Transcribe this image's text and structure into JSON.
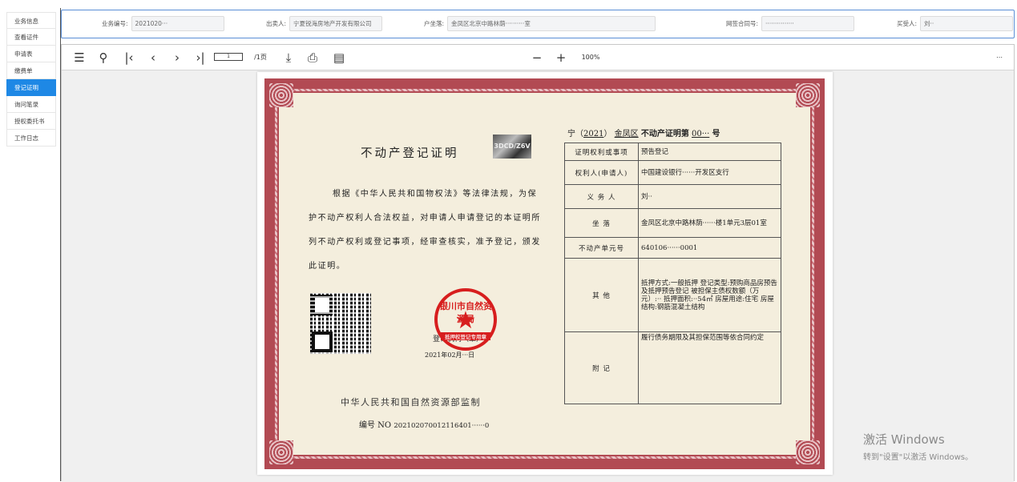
{
  "sidebar": {
    "items": [
      {
        "label": "业务信息",
        "active": false
      },
      {
        "label": "查看证件",
        "active": false
      },
      {
        "label": "申请表",
        "active": false
      },
      {
        "label": "缴费单",
        "active": false
      },
      {
        "label": "登记证明",
        "active": true
      },
      {
        "label": "询问笔录",
        "active": false
      },
      {
        "label": "授权委托书",
        "active": false
      },
      {
        "label": "工作日志",
        "active": false
      }
    ]
  },
  "info_bar": {
    "business_no_label": "业务编号:",
    "business_no_value": "2021020···",
    "seller_label": "出卖人:",
    "seller_value": "宁夏锐海房地产开发有限公司",
    "property_label": "户坐落:",
    "property_value": "金凤区北京中路林荫··········室",
    "contract_label": "网签合同号:",
    "contract_value": "···············",
    "buyer_label": "买受人:",
    "buyer_value": "刘··"
  },
  "viewer": {
    "page_input": "1",
    "page_total": "/1页",
    "zoom": "100%",
    "accent": "#1e88e5"
  },
  "certificate": {
    "title": "不动产登记证明",
    "holo_label": "3DCD/Z6V",
    "body": "根据《中华人民共和国物权法》等法律法规，为保护不动产权利人合法权益，对申请人申请登记的本证明所列不动产权利或登记事项，经审查核实，准予登记，颁发此证明。",
    "seal_text": "银川市自然资源局",
    "seal_sub": "抵押权登记专用章",
    "seal_org": "登记机构（章）",
    "seal_date": "2021年02月···日",
    "authority": "中华人民共和国自然资源部监制",
    "serial_label": "编号 NO",
    "serial_value": "202102070012116401······0",
    "no_prefix": "宁（",
    "no_year": "2021",
    "no_mid": "）",
    "no_district": "金凤区",
    "no_type": "不动产证明第",
    "no_value": "00···",
    "no_suffix": "号",
    "rows": [
      {
        "k": "证明权利或事项",
        "v": "预告登记"
      },
      {
        "k": "权利人(申请人)",
        "v": "中国建设银行······开发区支行"
      },
      {
        "k": "义 务 人",
        "v": "刘··"
      },
      {
        "k": "坐 落",
        "v": "金凤区北京中路林荫······楼1单元3层01室"
      },
      {
        "k": "不动产单元号",
        "v": "640106······0001"
      },
      {
        "k": "其 他",
        "v": "抵押方式:一般抵押 登记类型:预购商品房预告及抵押预告登记 被担保主债权数额（万元）:·· 抵押面积:··54㎡ 房屋用途:住宅 房屋结构:钢筋混凝土结构"
      },
      {
        "k": "附 记",
        "v": "履行债务期限及其担保范围等依合同约定"
      }
    ]
  },
  "windows_watermark": {
    "line1": "激活 Windows",
    "line2": "转到\"设置\"以激活 Windows。"
  }
}
